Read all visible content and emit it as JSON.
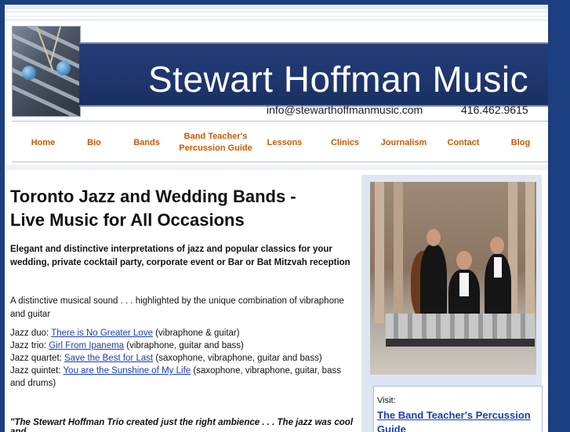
{
  "header": {
    "title": "Stewart Hoffman Music",
    "email": "info@stewarthoffmanmusic.com",
    "phone": "416.462.9615"
  },
  "nav": {
    "items": [
      {
        "label": "Home"
      },
      {
        "label": "Bio"
      },
      {
        "label": "Bands"
      },
      {
        "label_line1": "Band Teacher's",
        "label_line2": "Percussion Guide"
      },
      {
        "label": "Lessons"
      },
      {
        "label": "Clinics"
      },
      {
        "label": "Journalism"
      },
      {
        "label": "Contact"
      },
      {
        "label": "Blog"
      }
    ]
  },
  "main": {
    "heading_line1": "Toronto Jazz and Wedding Bands -",
    "heading_line2": "Live Music for All Occasions",
    "intro": "Elegant and distinctive interpretations of jazz and popular classics for your wedding, private cocktail party, corporate event or Bar or Bat Mitzvah reception",
    "description": "A distinctive musical sound . . . highlighted by the unique combination of vibraphone and guitar",
    "lineups": [
      {
        "label": "Jazz duo: ",
        "link": "There is No Greater Love",
        "detail": " (vibraphone & guitar)"
      },
      {
        "label": "Jazz trio: ",
        "link": "Girl From Ipanema",
        "detail": " (vibraphone, guitar and bass)"
      },
      {
        "label": "Jazz quartet: ",
        "link": "Save the Best for Last",
        "detail": " (saxophone, vibraphone, guitar and bass)"
      },
      {
        "label": "Jazz quintet: ",
        "link": "You are the Sunshine of My Life",
        "detail": " (saxophone, vibraphone, guitar, bass and drums)"
      }
    ],
    "quote": "\"The Stewart Hoffman Trio created just the right ambience . . . The jazz was cool and"
  },
  "sidebar": {
    "visit_label": "Visit:",
    "visit_link": "The Band Teacher's Percussion Guide"
  },
  "colors": {
    "background": "#1c3f7f",
    "banner": "#1f3770",
    "nav_text": "#c75b00",
    "link": "#1a3fb0",
    "sidebar": "#dde7f3"
  }
}
